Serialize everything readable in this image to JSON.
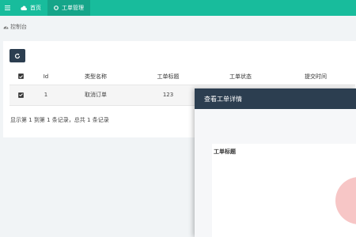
{
  "nav": {
    "items": [
      {
        "label": "首页",
        "icon": "cloud-icon"
      },
      {
        "label": "工单管理",
        "icon": "circle-icon"
      }
    ]
  },
  "breadcrumb": {
    "label": "控制台",
    "icon": "dashboard-icon"
  },
  "toolbar": {
    "refresh_icon": "refresh-icon"
  },
  "table": {
    "headers": [
      "Id",
      "类型名称",
      "工单标题",
      "工单状态",
      "提交时间"
    ],
    "rows": [
      {
        "id": "1",
        "type": "取消订单",
        "title": "123",
        "checked": true
      }
    ],
    "header_checked": true
  },
  "pager": {
    "text": "显示第 1 到第 1 条记录，总共 1 条记录"
  },
  "modal": {
    "title": "查看工单详情",
    "inner_title": "工单标题"
  },
  "colors": {
    "topbar": "#18bc9c",
    "active_tab": "#15a589",
    "dark": "#2c3e50",
    "stamp": "#f7c6c6"
  }
}
